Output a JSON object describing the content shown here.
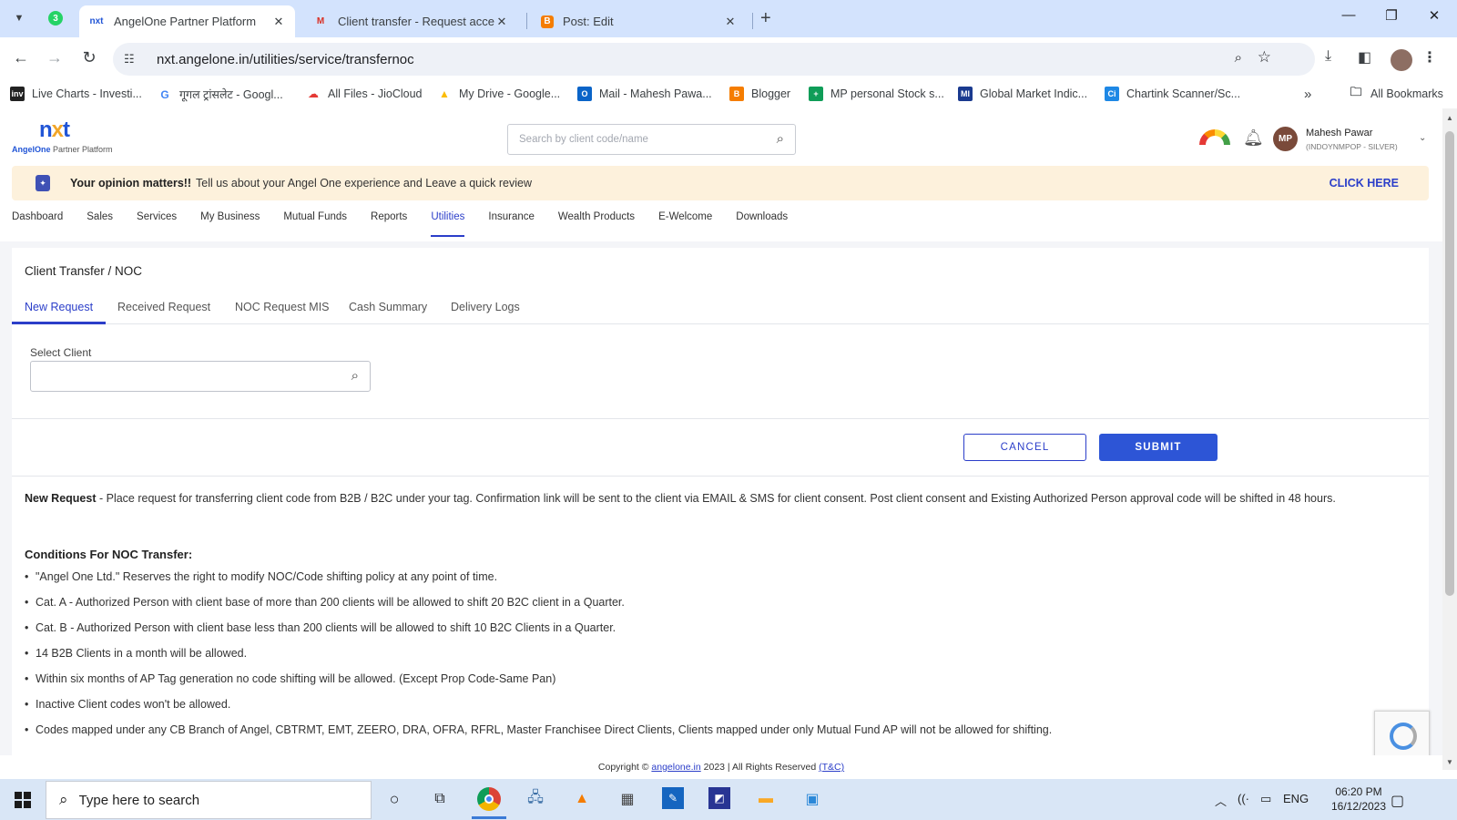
{
  "browser": {
    "tabs": [
      {
        "label": "AngelOne Partner Platform",
        "favicon": "nxt"
      },
      {
        "label": "Client transfer - Request accept",
        "favicon": "M"
      },
      {
        "label": "Post: Edit",
        "favicon": "B"
      }
    ],
    "ext_badge": "3",
    "url": "nxt.angelone.in/utilities/service/transfernoc",
    "bookmarks": [
      {
        "label": "Live Charts - Investi...",
        "icon": "inv"
      },
      {
        "label": "गूगल ट्रांसलेट - Googl...",
        "icon": "G"
      },
      {
        "label": "All Files - JioCloud",
        "icon": "cloud"
      },
      {
        "label": "My Drive - Google...",
        "icon": "drive"
      },
      {
        "label": "Mail - Mahesh Pawa...",
        "icon": "outlook"
      },
      {
        "label": "Blogger",
        "icon": "B"
      },
      {
        "label": "MP personal Stock s...",
        "icon": "sheets"
      },
      {
        "label": "Global Market Indic...",
        "icon": "MI"
      },
      {
        "label": "Chartink Scanner/Sc...",
        "icon": "Ci"
      }
    ],
    "all_bookmarks": "All Bookmarks"
  },
  "app": {
    "logo_text": "nxt",
    "logo_sub_brand": "AngelOne",
    "logo_sub_rest": " Partner Platform",
    "search_placeholder": "Search by client code/name",
    "user": {
      "initials": "MP",
      "name": "Mahesh Pawar",
      "code": "(INDOYNMPOP - SILVER)"
    },
    "banner": {
      "bold": "Your opinion matters!!",
      "text": "Tell us about your Angel One experience and Leave a quick review",
      "cta": "CLICK HERE"
    },
    "nav": [
      "Dashboard",
      "Sales",
      "Services",
      "My Business",
      "Mutual Funds",
      "Reports",
      "Utilities",
      "Insurance",
      "Wealth Products",
      "E-Welcome",
      "Downloads"
    ],
    "nav_active": "Utilities"
  },
  "main": {
    "breadcrumb": "Client Transfer / NOC",
    "tabs": [
      "New Request",
      "Received Request",
      "NOC Request MIS",
      "Cash Summary",
      "Delivery Logs"
    ],
    "select_client_label": "Select Client",
    "select_client_value": "",
    "cancel_label": "CANCEL",
    "submit_label": "SUBMIT",
    "desc_bold": "New Request",
    "desc_text": " - Place request for transferring client code from B2B / B2C under your tag. Confirmation link will be sent to the client via EMAIL & SMS for client consent. Post client consent and Existing Authorized Person approval code will be shifted in 48 hours.",
    "conditions_title": "Conditions For NOC Transfer:",
    "conditions": [
      "\"Angel One Ltd.\" Reserves the right to modify NOC/Code shifting policy at any point of time.",
      "Cat. A - Authorized Person with client base of more than 200 clients will be allowed to shift 20 B2C client in a Quarter.",
      "Cat. B - Authorized Person with client base less than 200 clients will be allowed to shift 10 B2C Clients in a Quarter.",
      "14 B2B Clients in a month will be allowed.",
      "Within six months of AP Tag generation no code shifting will be allowed. (Except Prop Code-Same Pan)",
      "Inactive Client codes won't be allowed.",
      "Codes mapped under any CB Branch of Angel, CBTRMT, EMT, ZEERO, DRA, OFRA, RFRL, Master Franchisee Direct Clients, Clients mapped under only Mutual Fund AP will not be allowed for shifting."
    ],
    "footer_prefix": "Copyright © ",
    "footer_link": "angelone.in",
    "footer_mid": " 2023 | All Rights Reserved ",
    "footer_tc": "(T&C)"
  },
  "taskbar": {
    "search_placeholder": "Type here to search",
    "lang": "ENG",
    "time": "06:20 PM",
    "date": "16/12/2023"
  },
  "colors": {
    "accent": "#2b3ec9",
    "submit": "#2d55d6",
    "banner_bg": "#fdf1dc",
    "tabstrip": "#d3e3fd"
  }
}
